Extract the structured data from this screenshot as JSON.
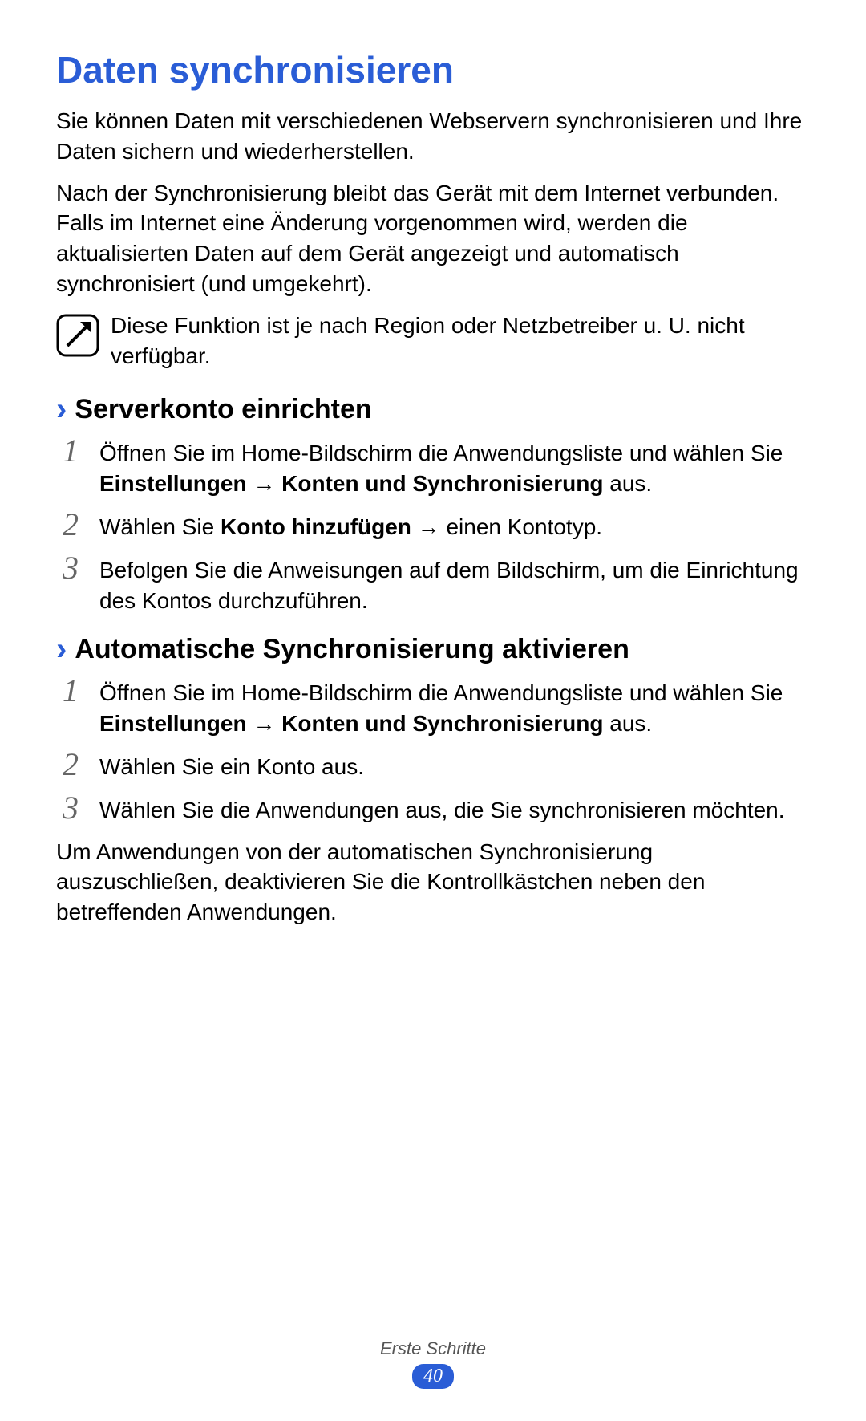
{
  "title": "Daten synchronisieren",
  "intro1": "Sie können Daten mit verschiedenen Webservern synchronisieren und Ihre Daten sichern und wiederherstellen.",
  "intro2": "Nach der Synchronisierung bleibt das Gerät mit dem Internet verbunden. Falls im Internet eine Änderung vorgenommen wird, werden die aktualisierten Daten auf dem Gerät angezeigt und automatisch synchronisiert (und umgekehrt).",
  "note": "Diese Funktion ist je nach Region oder Netzbetreiber u. U. nicht verfügbar.",
  "section1": {
    "title": "Serverkonto einrichten",
    "num1": "1",
    "num2": "2",
    "num3": "3",
    "step1_a": "Öffnen Sie im Home-Bildschirm die Anwendungsliste und wählen Sie ",
    "step1_b": "Einstellungen",
    "step1_c": " → ",
    "step1_d": "Konten und Synchronisierung",
    "step1_e": " aus.",
    "step2_a": "Wählen Sie ",
    "step2_b": "Konto hinzufügen",
    "step2_c": " → einen Kontotyp.",
    "step3": "Befolgen Sie die Anweisungen auf dem Bildschirm, um die Einrichtung des Kontos durchzuführen."
  },
  "section2": {
    "title": "Automatische Synchronisierung aktivieren",
    "num1": "1",
    "num2": "2",
    "num3": "3",
    "step1_a": "Öffnen Sie im Home-Bildschirm die Anwendungsliste und wählen Sie ",
    "step1_b": "Einstellungen",
    "step1_c": " → ",
    "step1_d": "Konten und Synchronisierung",
    "step1_e": " aus.",
    "step2": "Wählen Sie ein Konto aus.",
    "step3": "Wählen Sie die Anwendungen aus, die Sie synchronisieren möchten."
  },
  "closing": "Um Anwendungen von der automatischen Synchronisierung auszuschließen, deaktivieren Sie die Kontrollkästchen neben den betreffenden Anwendungen.",
  "footer": {
    "section": "Erste Schritte",
    "page": "40"
  }
}
